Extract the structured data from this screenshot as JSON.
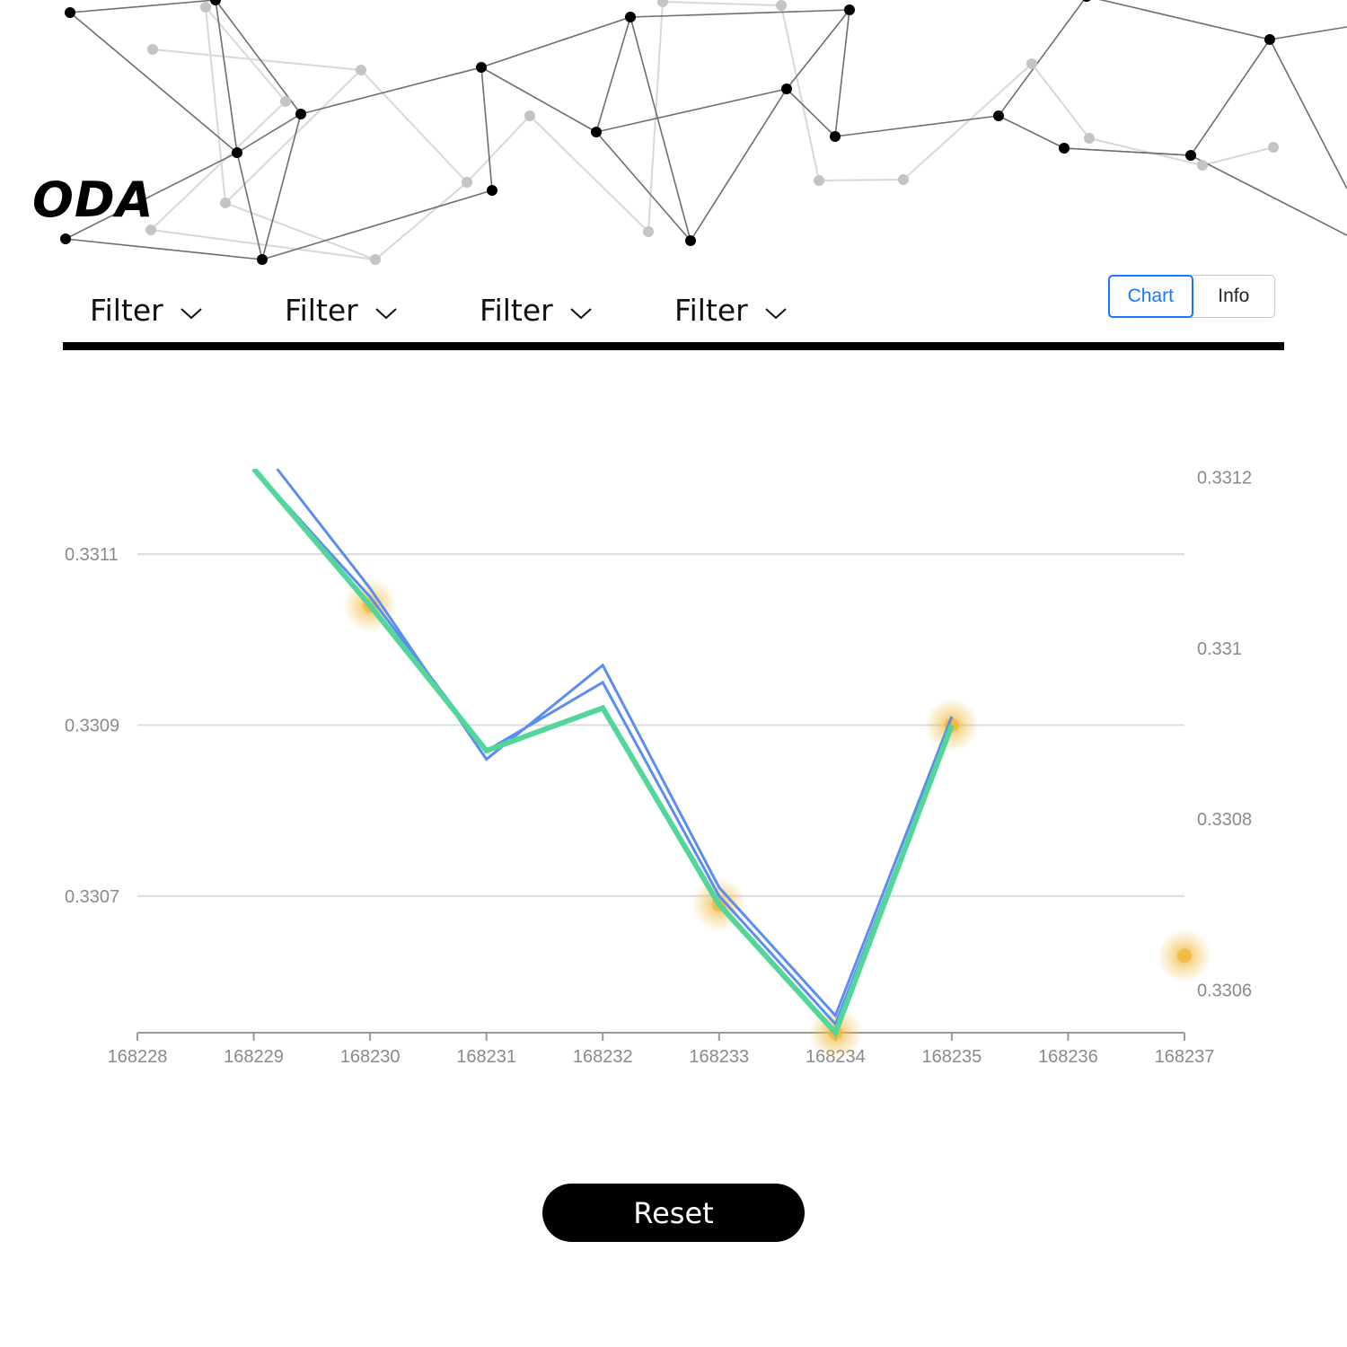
{
  "brand": {
    "logo_text": "ODA"
  },
  "filters": [
    {
      "label": "Filter",
      "icon": "chevron-down-icon"
    },
    {
      "label": "Filter",
      "icon": "chevron-down-icon"
    },
    {
      "label": "Filter",
      "icon": "chevron-down-icon"
    },
    {
      "label": "Filter",
      "icon": "chevron-down-icon"
    }
  ],
  "view_toggle": {
    "chart_label": "Chart",
    "info_label": "Info",
    "active": "Chart"
  },
  "reset_label": "Reset",
  "colors": {
    "accent": "#1677ff",
    "line_blue": "#5b8def",
    "line_green": "#52d69a",
    "highlight": "#f0b73a"
  },
  "chart_data": {
    "type": "line",
    "x_ticks": [
      "168228",
      "168229",
      "168230",
      "168231",
      "168232",
      "168233",
      "168234",
      "168235",
      "168236",
      "168237"
    ],
    "xlim": [
      168228,
      168237
    ],
    "left_axis": {
      "ticks": [
        "0.3311",
        "0.3309",
        "0.3307"
      ],
      "ylim": [
        0.33054,
        0.3312
      ]
    },
    "right_axis": {
      "ticks": [
        "0.3312",
        "0.331",
        "0.3308",
        "0.3306"
      ],
      "ylim": [
        0.33055,
        0.33121
      ]
    },
    "grid": true,
    "series": [
      {
        "color": "#5b8def",
        "axis": "left",
        "x": [
          168229.2,
          168230,
          168231,
          168232,
          168233,
          168234,
          168235
        ],
        "y": [
          0.3312,
          0.33106,
          0.33086,
          0.33097,
          0.33071,
          0.33056,
          0.33091
        ]
      },
      {
        "color": "#5b8def",
        "axis": "left",
        "x": [
          168229,
          168230,
          168231,
          168232,
          168233,
          168234,
          168235
        ],
        "y": [
          0.3312,
          0.33105,
          0.33087,
          0.33095,
          0.3307,
          0.33055,
          0.3309
        ]
      },
      {
        "color": "#52d69a",
        "axis": "left",
        "x": [
          168229,
          168230,
          168231,
          168232,
          168233,
          168234,
          168235
        ],
        "y": [
          0.3312,
          0.33104,
          0.33087,
          0.33092,
          0.33069,
          0.33054,
          0.3309
        ]
      }
    ],
    "highlights": [
      {
        "x": 168230,
        "y": 0.33104
      },
      {
        "x": 168233,
        "y": 0.33069
      },
      {
        "x": 168234,
        "y": 0.33054
      },
      {
        "x": 168235,
        "y": 0.3309
      },
      {
        "x": 168237,
        "y": 0.33063
      }
    ]
  }
}
